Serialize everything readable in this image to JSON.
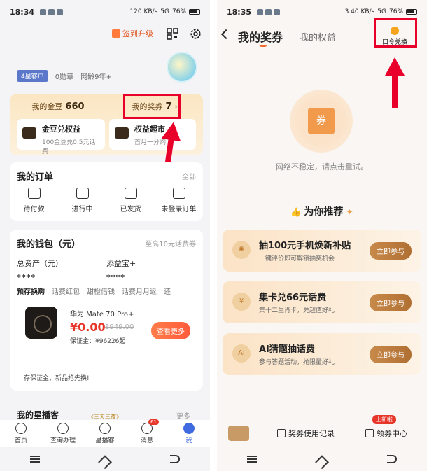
{
  "left": {
    "status": {
      "time": "18:34",
      "signal": "120 KB/s",
      "network": "5G",
      "battery": "76%"
    },
    "header": {
      "signin_label": "签到升级"
    },
    "badges": {
      "star_customer": "4星客户",
      "medals": "0勋章",
      "tenure": "网龄9年+"
    },
    "beans": {
      "my_beans_label": "我的金豆",
      "my_beans_value": "660",
      "my_prizes_label": "我的奖券",
      "my_prizes_value": "7",
      "exchange_title": "金豆兑权益",
      "exchange_sub": "100金豆兑0.5元话费",
      "market_title": "权益超市",
      "market_sub": "首月一分购"
    },
    "orders": {
      "title": "我的订单",
      "all_label": "全部",
      "items": [
        "待付款",
        "进行中",
        "已发货",
        "未登录订单"
      ]
    },
    "wallet": {
      "title": "我的钱包（元）",
      "link": "至高10元话费券",
      "assets_label": "总资产（元）",
      "assets_value": "****",
      "tianyi_label": "添益宝+",
      "tianyi_value": "****",
      "tabs": [
        "预存换购",
        "话费红包",
        "甜橙借钱",
        "话费月月返",
        "还"
      ],
      "promo": {
        "name": "华为 Mate 70 Pro+",
        "price": "¥0.00",
        "old_price": "8949.00",
        "deposit": "保证金：¥96226起",
        "button": "查看更多"
      },
      "note": "存保证金，新品抢先换!"
    },
    "star": {
      "title": "我的星播客",
      "tag": "《三天三夜》",
      "more": "更多"
    },
    "tabbar": [
      "首页",
      "查询办理",
      "星播客",
      "消息",
      "我"
    ],
    "message_badge": "61"
  },
  "right": {
    "status": {
      "time": "18:35",
      "signal": "3.40 KB/s",
      "network": "5G",
      "battery": "76%"
    },
    "header": {
      "tab_coupons": "我的奖券",
      "tab_rights": "我的权益",
      "redeem_label": "口令兑换"
    },
    "coupon_glyph": "券",
    "network_tip": "网络不稳定，请点击重试。",
    "recommend_title": "为你推荐",
    "cards": [
      {
        "title": "抽100元手机焕新补贴",
        "sub": "一键评价即可解锁抽奖机会",
        "button": "立即参与",
        "icon": "wheel"
      },
      {
        "title": "集卡兑66元话费",
        "sub": "集十二生肖卡，兑超值好礼",
        "button": "立即参与",
        "icon": "¥"
      },
      {
        "title": "AI猜题抽话费",
        "sub": "参与答题活动，抢限量好礼",
        "button": "立即参与",
        "icon": "AI"
      }
    ],
    "bottom": {
      "history": "奖券使用记录",
      "center": "领券中心",
      "new_tag": "上新啦"
    }
  },
  "colors": {
    "highlight": "#e8002b",
    "accent_orange": "#f06b2b",
    "brown_btn": "#b06f33",
    "blue": "#3f6ae0"
  }
}
